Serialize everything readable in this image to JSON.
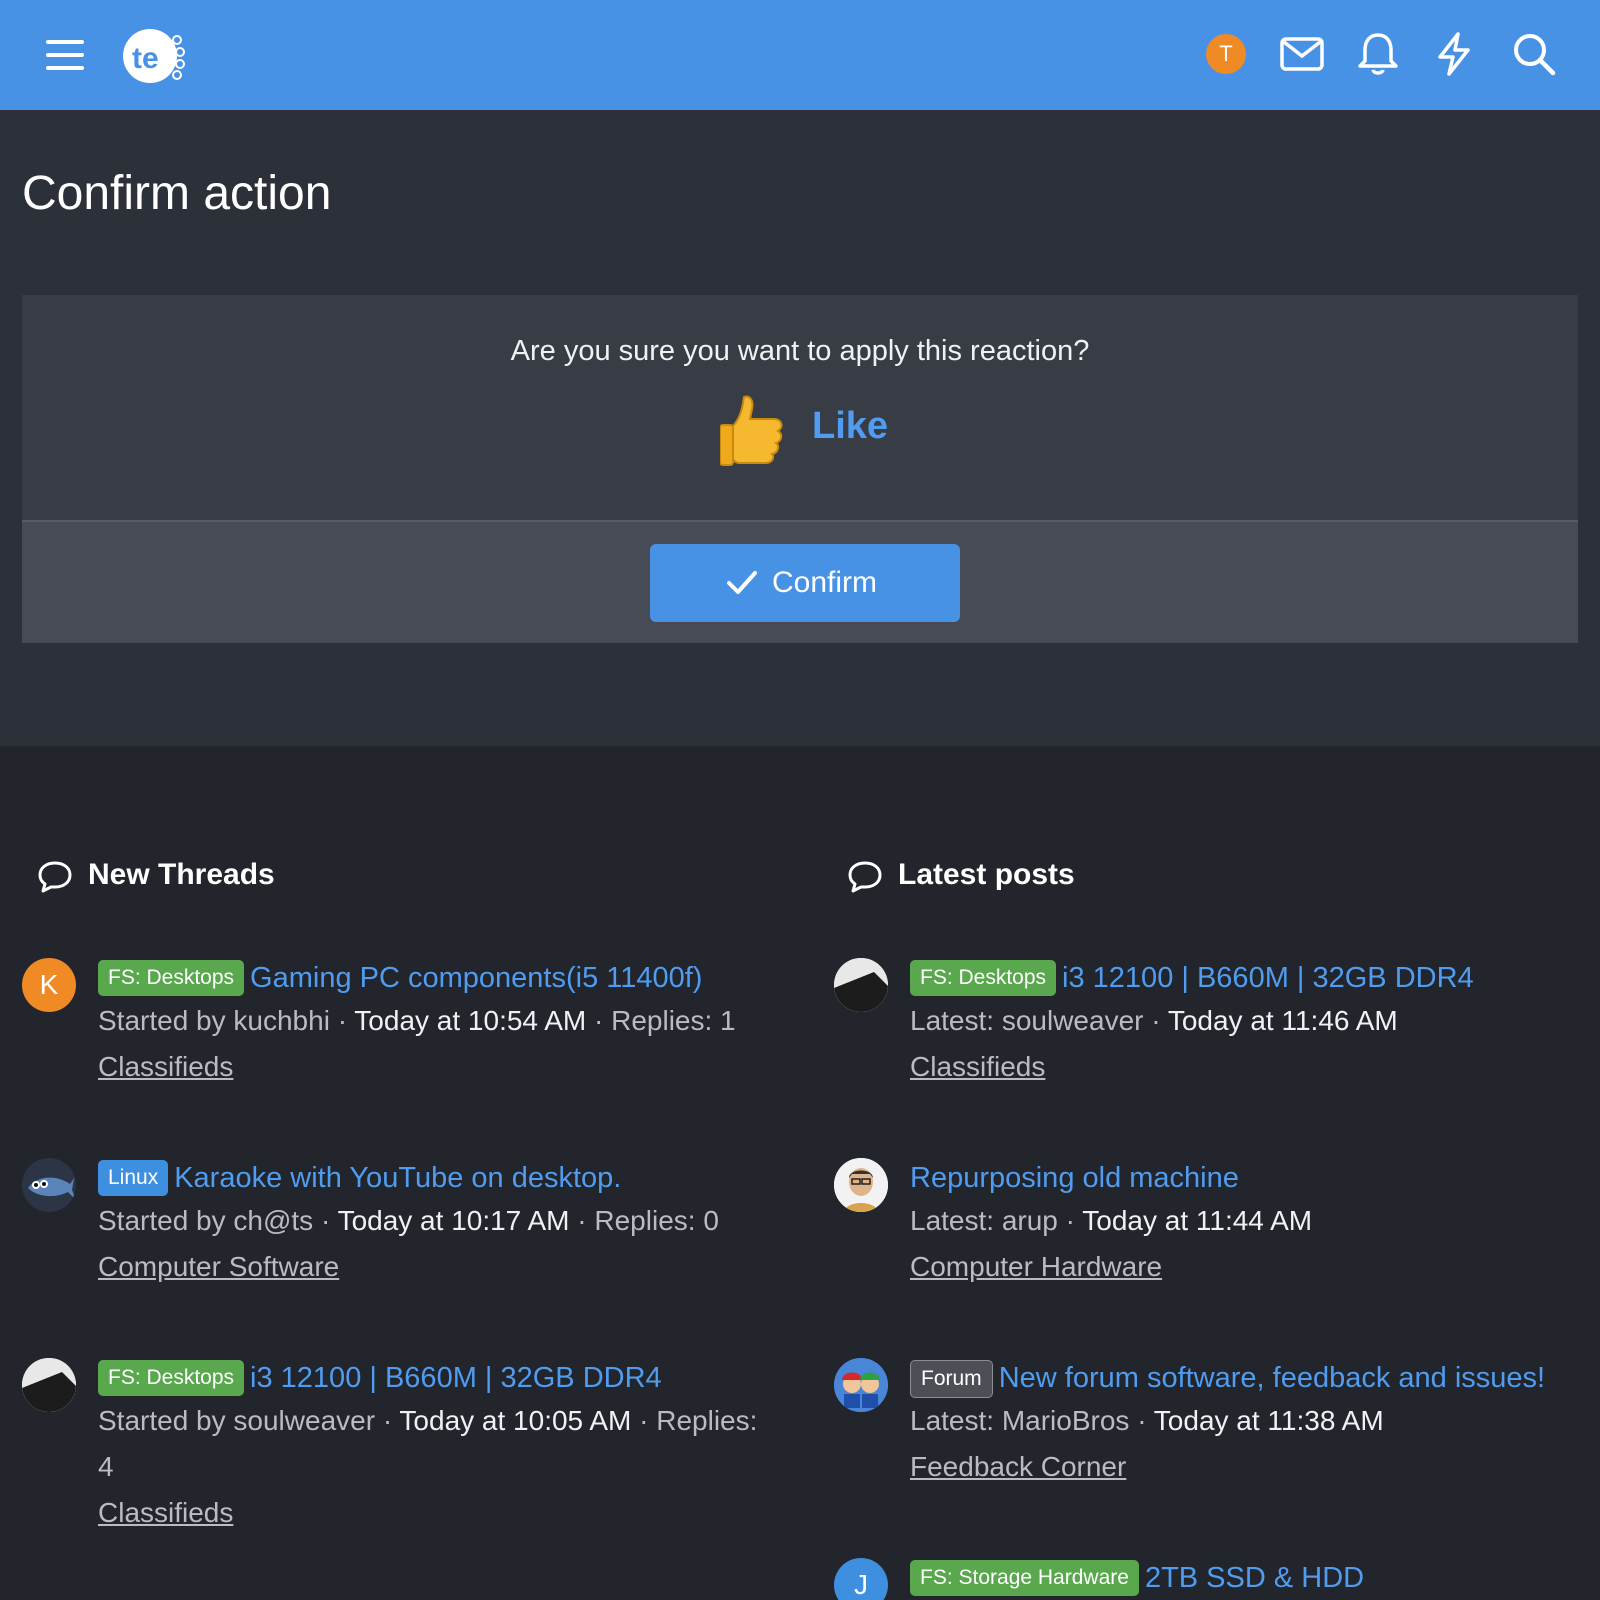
{
  "header": {
    "user_initial": "T",
    "icons": [
      "menu-icon",
      "mail-icon",
      "bell-icon",
      "lightning-icon",
      "search-icon"
    ]
  },
  "confirm": {
    "page_title": "Confirm action",
    "question": "Are you sure you want to apply this reaction?",
    "reaction_label": "Like",
    "confirm_label": "Confirm"
  },
  "new_threads": {
    "heading": "New Threads",
    "items": [
      {
        "initial": "K",
        "tag": "FS: Desktops",
        "title": "Gaming PC components(i5 11400f)",
        "meta_prefix": "Started by kuchbhi · ",
        "time": "Today at 10:54 AM",
        "meta_suffix": " · Replies: 1",
        "forum": "Classifieds"
      },
      {
        "initial": "",
        "tag": "Linux",
        "title": "Karaoke with YouTube on desktop.",
        "meta_prefix": "Started by ch@ts · ",
        "time": "Today at 10:17 AM",
        "meta_suffix": " · Replies: 0",
        "forum": "Computer Software"
      },
      {
        "initial": "",
        "tag": "FS: Desktops",
        "title": "i3 12100 | B660M | 32GB DDR4",
        "meta_prefix": "Started by soulweaver · ",
        "time": "Today at 10:05 AM",
        "meta_suffix": " · Replies:",
        "meta_wrap": "4",
        "forum": "Classifieds"
      }
    ]
  },
  "latest_posts": {
    "heading": "Latest posts",
    "items": [
      {
        "initial": "",
        "tag": "FS: Desktops",
        "title": "i3 12100 | B660M | 32GB DDR4",
        "meta_prefix": "Latest: soulweaver · ",
        "time": "Today at 11:46 AM",
        "forum": "Classifieds"
      },
      {
        "initial": "",
        "tag": "",
        "title": "Repurposing old machine",
        "meta_prefix": "Latest: arup · ",
        "time": "Today at 11:44 AM",
        "forum": "Computer Hardware"
      },
      {
        "initial": "",
        "tag": "Forum",
        "title": "New forum software, feedback and issues!",
        "meta_prefix": "Latest: MarioBros · ",
        "time": "Today at 11:38 AM",
        "forum": "Feedback Corner"
      },
      {
        "initial": "J",
        "tag": "FS: Storage Hardware",
        "title": "2TB SSD & HDD"
      }
    ]
  },
  "colors": {
    "header": "#4892e6",
    "link": "#4f9cf0",
    "tag_green": "#5aa84e",
    "tag_blue": "#3f8fe0"
  }
}
